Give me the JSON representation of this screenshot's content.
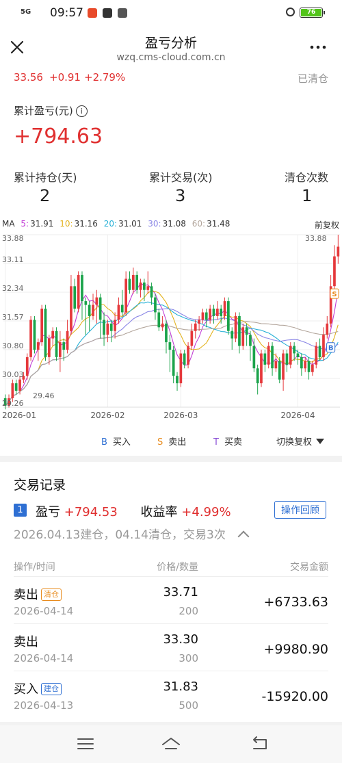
{
  "status_bar": {
    "network": "5G",
    "time": "09:57",
    "battery": "76"
  },
  "header": {
    "title": "盈亏分析",
    "url": "wzq.cms-cloud.com.cn"
  },
  "summary": {
    "price": "33.56",
    "change": "+0.91",
    "change_pct": "+2.79%",
    "status": "已清仓",
    "pl_label": "累计盈亏(元)",
    "pl_value": "+794.63",
    "stats": [
      {
        "label": "累计持仓(天)",
        "value": "2"
      },
      {
        "label": "累计交易(次)",
        "value": "3"
      },
      {
        "label": "清仓次数",
        "value": "1"
      }
    ]
  },
  "chart_data": {
    "type": "candlestick",
    "ma_label": "MA",
    "ma_values": [
      {
        "label": "5:",
        "value": "31.91",
        "color": "#c23fd6"
      },
      {
        "label": "10:",
        "value": "31.16",
        "color": "#e3b21c"
      },
      {
        "label": "20:",
        "value": "31.01",
        "color": "#26b0d6"
      },
      {
        "label": "30:",
        "value": "31.08",
        "color": "#8a86e6"
      },
      {
        "label": "60:",
        "value": "31.48",
        "color": "#b3a69c"
      }
    ],
    "adjust_label": "前复权",
    "y_ticks": [
      "33.88",
      "33.11",
      "32.34",
      "31.57",
      "30.80",
      "30.03",
      "29.26"
    ],
    "ylim": [
      29.26,
      33.88
    ],
    "x_ticks": [
      {
        "label": "2026-01",
        "index": 0
      },
      {
        "label": "2026-02",
        "index": 28
      },
      {
        "label": "2026-03",
        "index": 48
      },
      {
        "label": "2026-04",
        "index": 80
      }
    ],
    "max_label": "33.88",
    "min_label": "29.46",
    "candles": [
      [
        29.5,
        29.3,
        29.6,
        29.2
      ],
      [
        29.3,
        29.5,
        29.6,
        29.25
      ],
      [
        29.5,
        29.9,
        30.0,
        29.4
      ],
      [
        29.9,
        29.7,
        30.0,
        29.6
      ],
      [
        29.7,
        30.0,
        30.1,
        29.6
      ],
      [
        30.0,
        30.1,
        30.2,
        29.9
      ],
      [
        30.1,
        30.6,
        30.7,
        30.0
      ],
      [
        30.6,
        31.6,
        31.7,
        30.5
      ],
      [
        31.6,
        30.8,
        31.7,
        30.7
      ],
      [
        30.8,
        31.0,
        31.1,
        30.5
      ],
      [
        31.0,
        31.9,
        32.0,
        30.9
      ],
      [
        31.9,
        30.6,
        32.0,
        30.5
      ],
      [
        30.6,
        31.1,
        31.2,
        30.4
      ],
      [
        31.1,
        31.3,
        31.4,
        30.9
      ],
      [
        31.3,
        30.6,
        31.4,
        30.5
      ],
      [
        30.6,
        31.0,
        31.3,
        30.2
      ],
      [
        31.0,
        30.8,
        31.1,
        30.5
      ],
      [
        30.8,
        31.3,
        31.6,
        30.7
      ],
      [
        31.3,
        32.5,
        32.8,
        31.2
      ],
      [
        32.5,
        31.9,
        32.7,
        31.8
      ],
      [
        31.9,
        32.8,
        32.9,
        31.8
      ],
      [
        32.8,
        32.1,
        32.9,
        31.6
      ],
      [
        32.1,
        32.0,
        32.2,
        31.2
      ],
      [
        32.0,
        31.7,
        32.1,
        31.3
      ],
      [
        31.7,
        32.0,
        32.3,
        31.6
      ],
      [
        32.0,
        32.2,
        32.4,
        31.5
      ],
      [
        32.2,
        31.6,
        32.3,
        31.1
      ],
      [
        31.6,
        31.2,
        31.8,
        30.9
      ],
      [
        31.2,
        31.5,
        31.6,
        31.0
      ],
      [
        31.5,
        31.3,
        31.6,
        31.0
      ],
      [
        31.3,
        31.6,
        31.8,
        31.1
      ],
      [
        31.6,
        32.0,
        32.2,
        31.5
      ],
      [
        32.0,
        31.8,
        32.4,
        31.7
      ],
      [
        31.8,
        32.7,
        32.9,
        31.7
      ],
      [
        32.7,
        32.4,
        32.9,
        32.3
      ],
      [
        32.4,
        32.8,
        33.0,
        32.3
      ],
      [
        32.8,
        32.4,
        32.9,
        32.3
      ],
      [
        32.4,
        32.6,
        32.7,
        32.2
      ],
      [
        32.6,
        32.4,
        32.7,
        32.1
      ],
      [
        32.4,
        32.5,
        32.9,
        32.3
      ],
      [
        32.5,
        32.2,
        32.6,
        32.0
      ],
      [
        32.2,
        31.8,
        32.3,
        31.6
      ],
      [
        31.8,
        31.4,
        31.9,
        31.3
      ],
      [
        31.4,
        31.5,
        31.7,
        31.3
      ],
      [
        31.5,
        31.0,
        31.6,
        30.7
      ],
      [
        31.0,
        30.8,
        31.2,
        30.2
      ],
      [
        30.8,
        30.1,
        30.9,
        29.9
      ],
      [
        30.1,
        29.9,
        30.2,
        29.7
      ],
      [
        29.9,
        30.7,
        30.8,
        29.8
      ],
      [
        30.7,
        30.4,
        30.8,
        30.3
      ],
      [
        30.4,
        30.9,
        31.0,
        30.3
      ],
      [
        30.9,
        31.3,
        31.5,
        30.8
      ],
      [
        31.3,
        31.5,
        31.6,
        31.1
      ],
      [
        31.5,
        31.6,
        31.7,
        31.3
      ],
      [
        31.6,
        31.8,
        31.9,
        31.5
      ],
      [
        31.8,
        31.6,
        31.9,
        31.4
      ],
      [
        31.6,
        31.9,
        32.0,
        31.5
      ],
      [
        31.9,
        31.7,
        32.0,
        31.5
      ],
      [
        31.7,
        31.9,
        32.1,
        31.6
      ],
      [
        31.9,
        31.7,
        32.0,
        31.5
      ],
      [
        31.7,
        32.1,
        32.2,
        31.6
      ],
      [
        32.1,
        31.3,
        32.2,
        31.2
      ],
      [
        31.3,
        31.1,
        31.4,
        30.8
      ],
      [
        31.1,
        31.7,
        31.8,
        31.0
      ],
      [
        31.7,
        30.9,
        31.8,
        30.7
      ],
      [
        30.9,
        31.4,
        31.5,
        30.8
      ],
      [
        31.4,
        31.2,
        31.5,
        30.9
      ],
      [
        31.2,
        30.9,
        31.3,
        30.5
      ],
      [
        30.9,
        30.3,
        31.1,
        30.2
      ],
      [
        30.3,
        29.9,
        30.4,
        29.6
      ],
      [
        29.9,
        30.7,
        30.8,
        29.8
      ],
      [
        30.7,
        30.4,
        30.8,
        30.2
      ],
      [
        30.4,
        30.9,
        31.0,
        30.3
      ],
      [
        30.9,
        30.3,
        31.0,
        30.1
      ],
      [
        30.3,
        30.5,
        30.7,
        30.2
      ],
      [
        30.5,
        30.0,
        30.6,
        29.9
      ],
      [
        30.0,
        30.7,
        30.8,
        29.7
      ],
      [
        30.7,
        30.4,
        30.8,
        30.2
      ],
      [
        30.4,
        30.9,
        31.0,
        30.3
      ],
      [
        30.9,
        30.7,
        31.0,
        30.5
      ],
      [
        30.7,
        30.6,
        30.8,
        30.4
      ],
      [
        30.6,
        30.3,
        30.7,
        30.1
      ],
      [
        30.3,
        30.5,
        30.6,
        30.2
      ],
      [
        30.5,
        30.2,
        30.6,
        30.0
      ],
      [
        30.2,
        30.4,
        30.5,
        30.1
      ],
      [
        30.4,
        30.9,
        31.0,
        30.3
      ],
      [
        30.9,
        30.6,
        31.1,
        30.5
      ],
      [
        30.6,
        31.2,
        31.4,
        30.5
      ],
      [
        31.2,
        31.5,
        31.7,
        31.1
      ],
      [
        31.5,
        32.5,
        32.8,
        31.4
      ],
      [
        32.5,
        33.3,
        33.6,
        32.4
      ],
      [
        33.3,
        33.56,
        33.88,
        33.1
      ]
    ],
    "markers": [
      {
        "label": "B",
        "index": 89,
        "value": 30.86,
        "color": "#2e6fd3"
      },
      {
        "label": "S",
        "index": 90,
        "value": 32.3,
        "color": "#e88b1c"
      }
    ],
    "legend": [
      {
        "key": "B",
        "label": "买入",
        "color": "#2e6fd3"
      },
      {
        "key": "S",
        "label": "卖出",
        "color": "#e88b1c"
      },
      {
        "key": "T",
        "label": "买卖",
        "color": "#8a4fd6"
      }
    ],
    "switch_label": "切换复权"
  },
  "trades": {
    "title": "交易记录",
    "index": "1",
    "pl_label": "盈亏",
    "pl_value": "+794.53",
    "yield_label": "收益率",
    "yield_value": "+4.99%",
    "replay_label": "操作回顾",
    "period": "2026.04.13建仓，04.14清仓，交易3次",
    "columns": {
      "op": "操作/时间",
      "price": "价格/数量",
      "amount": "交易金额"
    },
    "rows": [
      {
        "action": "卖出",
        "tag": "清仓",
        "tag_color": "orange",
        "date": "2026-04-14",
        "price": "33.71",
        "qty": "200",
        "amount": "+6733.63"
      },
      {
        "action": "卖出",
        "tag": "",
        "tag_color": "",
        "date": "2026-04-14",
        "price": "33.30",
        "qty": "300",
        "amount": "+9980.90"
      },
      {
        "action": "买入",
        "tag": "建仓",
        "tag_color": "blue",
        "date": "2026-04-13",
        "price": "31.83",
        "qty": "500",
        "amount": "-15920.00"
      }
    ]
  }
}
